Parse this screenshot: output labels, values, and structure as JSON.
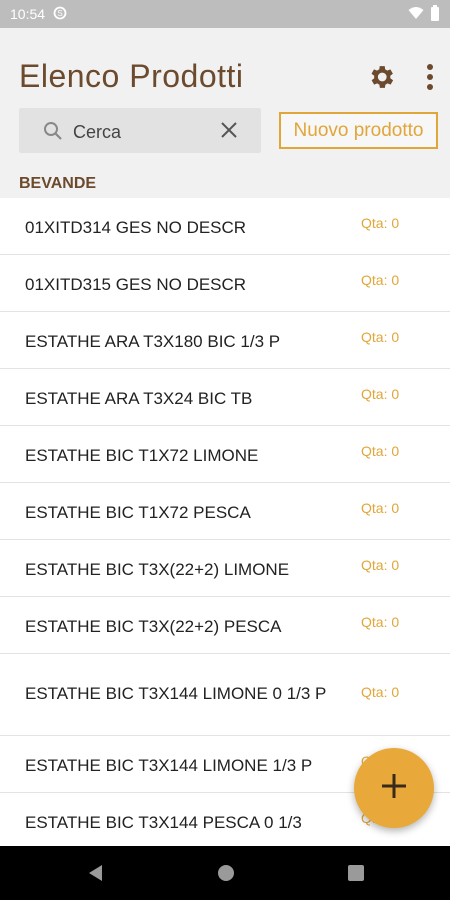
{
  "status_bar": {
    "time": "10:54",
    "icons": [
      "data-saver-icon",
      "wifi-icon",
      "battery-icon"
    ]
  },
  "header": {
    "title": "Elenco Prodotti",
    "settings_icon": "gear-icon",
    "menu_icon": "more-vert-icon"
  },
  "search": {
    "placeholder": "Cerca",
    "value": "",
    "clear_icon": "close-icon"
  },
  "new_product_label": "Nuovo prodotto",
  "section": "BEVANDE",
  "products": [
    {
      "name": "01XITD314 GES NO DESCR",
      "qty": "Qta: 0"
    },
    {
      "name": "01XITD315 GES NO DESCR",
      "qty": "Qta: 0"
    },
    {
      "name": "ESTATHE ARA T3X180 BIC 1/3 P",
      "qty": "Qta: 0"
    },
    {
      "name": "ESTATHE ARA T3X24 BIC TB",
      "qty": "Qta: 0"
    },
    {
      "name": "ESTATHE BIC T1X72 LIMONE",
      "qty": "Qta: 0"
    },
    {
      "name": "ESTATHE BIC T1X72 PESCA",
      "qty": "Qta: 0"
    },
    {
      "name": "ESTATHE BIC T3X(22+2) LIMONE",
      "qty": "Qta: 0"
    },
    {
      "name": "ESTATHE BIC T3X(22+2) PESCA",
      "qty": "Qta: 0"
    },
    {
      "name": "ESTATHE BIC T3X144 LIMONE 0 1/3 P",
      "qty": "Qta: 0"
    },
    {
      "name": "ESTATHE BIC T3X144 LIMONE 1/3 P",
      "qty": "Qta: 0"
    },
    {
      "name": "ESTATHE BIC T3X144 PESCA 0 1/3",
      "qty": "Qta: 0"
    }
  ],
  "fab_icon": "add-icon",
  "colors": {
    "brown": "#6b4a2d",
    "accent": "#e0a63a",
    "fab": "#e8a93a"
  }
}
